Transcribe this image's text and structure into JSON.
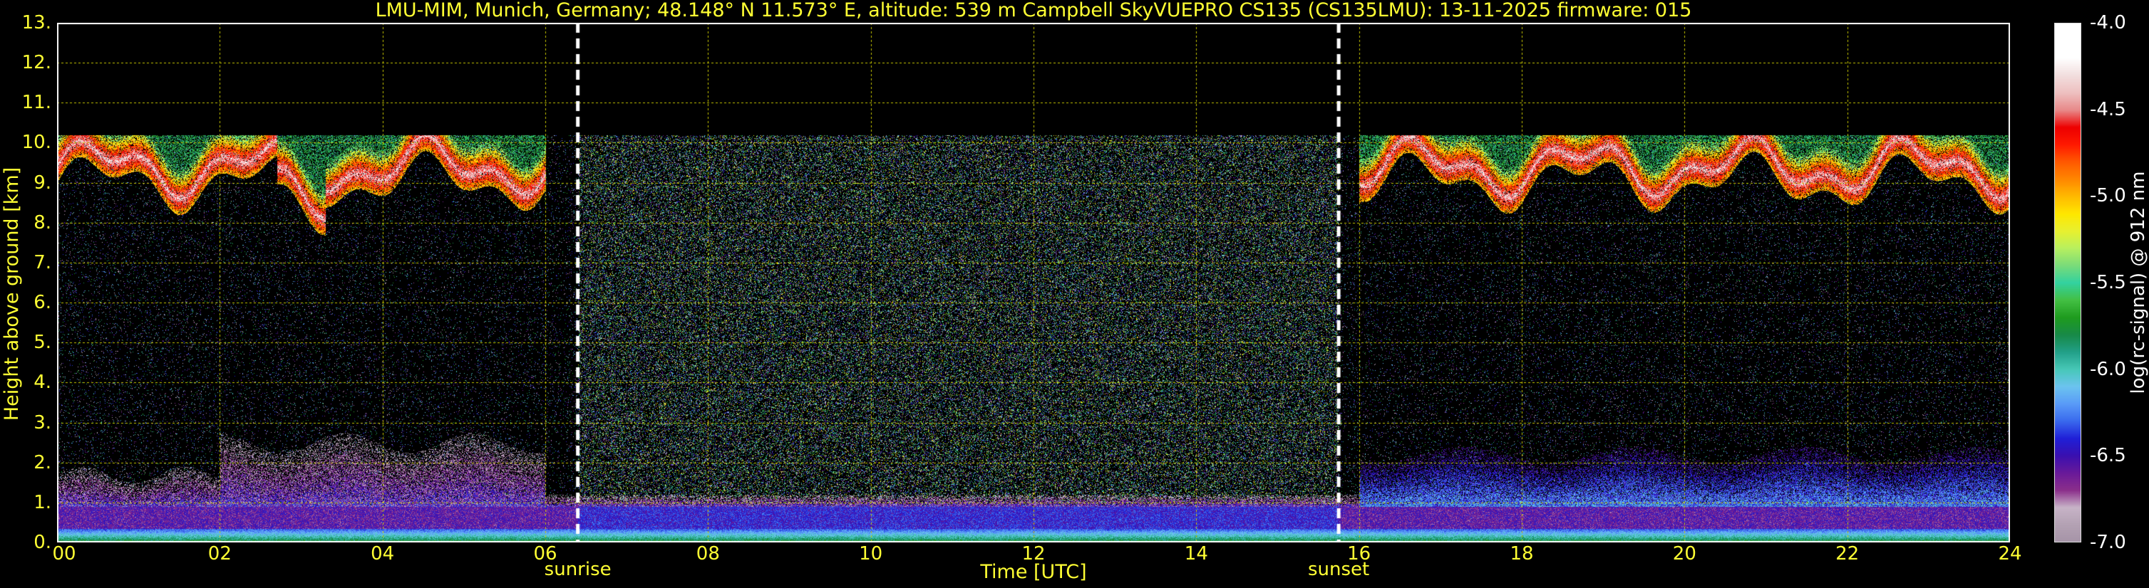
{
  "chart_data": {
    "type": "heatmap",
    "title": "LMU-MIM, Munich, Germany; 48.148° N 11.573° E, altitude: 539 m    Campbell SkyVUEPRO CS135 (CS135LMU): 13-11-2025    firmware: 015",
    "xlabel": "Time [UTC]",
    "ylabel": "Height above ground [km]",
    "xlim": [
      0,
      24
    ],
    "ylim": [
      0,
      13
    ],
    "x_ticks": [
      "00",
      "02",
      "04",
      "06",
      "08",
      "10",
      "12",
      "14",
      "16",
      "18",
      "20",
      "22",
      "24"
    ],
    "y_ticks": [
      "0.",
      "1.",
      "2.",
      "3.",
      "4.",
      "5.",
      "6.",
      "7.",
      "8.",
      "9.",
      "10.",
      "11.",
      "12.",
      "13."
    ],
    "grid": true,
    "markers": [
      {
        "label": "sunrise",
        "x": 6.4
      },
      {
        "label": "sunset",
        "x": 15.75
      }
    ],
    "colorbar": {
      "label": "log(rc-signal) @ 912 nm",
      "range": [
        -7.0,
        -4.0
      ],
      "ticks": [
        "-4.0",
        "-4.5",
        "-5.0",
        "-5.5",
        "-6.0",
        "-6.5",
        "-7.0"
      ],
      "colors": [
        "#a694a8",
        "#b4a2b4",
        "#c8b4c8",
        "#8b2f8b",
        "#6a1a9a",
        "#3a10b0",
        "#2020d8",
        "#3a6aee",
        "#5a9cf8",
        "#6cc4f0",
        "#48c8b8",
        "#22a088",
        "#188a48",
        "#1f9c1f",
        "#44c044",
        "#33d2a0",
        "#7adc7a",
        "#b8f060",
        "#e8f030",
        "#ffe800",
        "#ffbb00",
        "#ff8800",
        "#ff5a00",
        "#ff1a00",
        "#ee0000",
        "#e88a8a",
        "#eec0c0",
        "#f2dede",
        "#ffffff",
        "#ffffff",
        "#ffffff"
      ]
    },
    "observations": {
      "background_noise_top_km": 10.2,
      "high_cloud_periods_utc": [
        [
          0,
          6.0
        ],
        [
          16.0,
          24
        ]
      ],
      "high_cloud_base_km": [
        8.5,
        10.2
      ],
      "boundary_layer_top_km": [
        1.5,
        2.8
      ]
    }
  }
}
